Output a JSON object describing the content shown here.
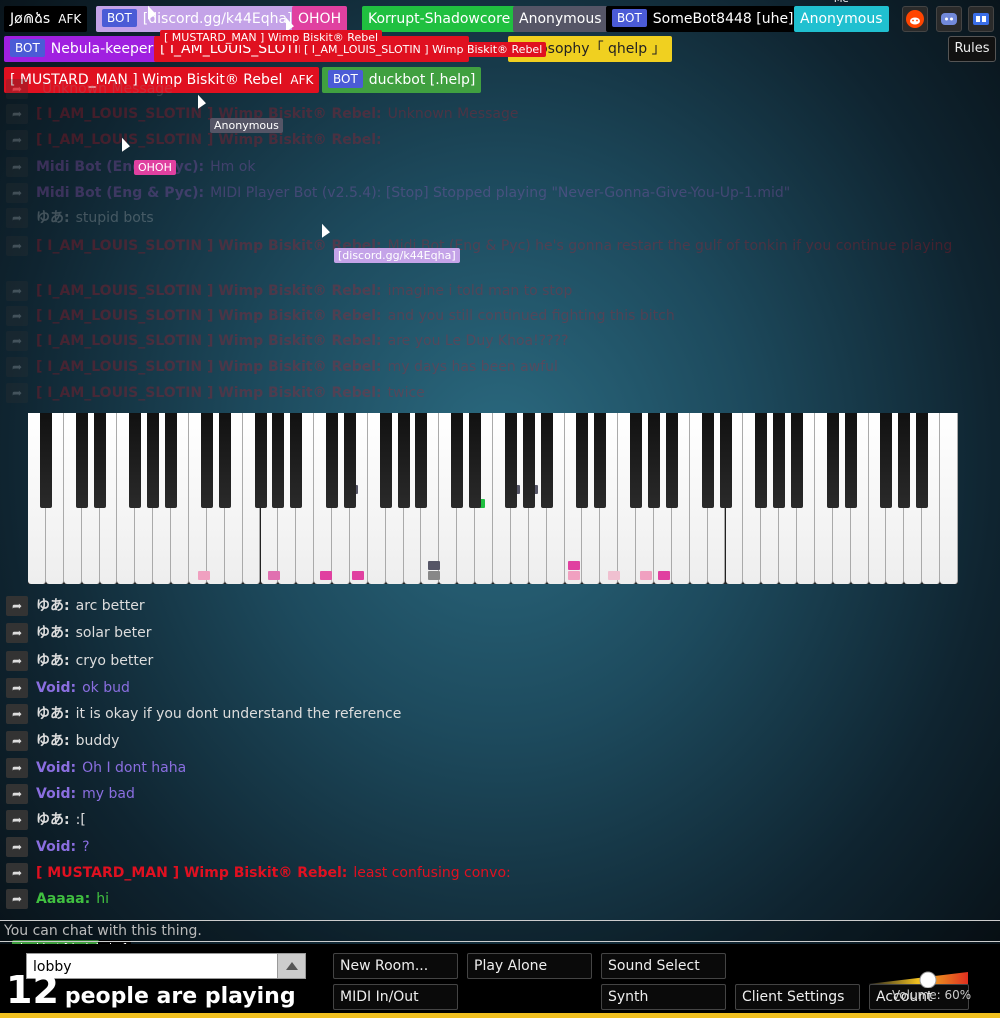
{
  "header": {
    "users": [
      {
        "name": "Jø⋒ձs",
        "afk": "AFK",
        "color": "#000000"
      },
      {
        "bot": "BOT",
        "name": "[discord.gg/k44Eqha]",
        "color": "#c4a3e8"
      },
      {
        "name": "OHOH",
        "color": "#e040a0"
      },
      {
        "name": "Korrupt-Shadowcore",
        "color": "#20c040"
      },
      {
        "name": "Anonymous",
        "color": "#555566"
      },
      {
        "bot": "BOT",
        "name": "SomeBot8448 [uhe]",
        "color": "#000000"
      },
      {
        "name": "Anonymous",
        "me": "Me",
        "color": "#20c0d0"
      },
      {
        "bot": "BOT",
        "name": "Nebula-keeper",
        "color": "#a020e0"
      },
      {
        "name": "[ I_AM_LOUIS_SLOTIN ] Wimp Biskit® Rebel",
        "color": "#e01020"
      },
      {
        "name": "Philosophy「 qhelp 」",
        "color": "#f0d020"
      },
      {
        "name": "[ MUSTARD_MAN ] Wimp Biskit® Rebel",
        "afk": "AFK",
        "color": "#e01020"
      },
      {
        "bot": "BOT",
        "name": "duckbot [.help]",
        "color": "#40a040"
      }
    ],
    "rules_label": "Rules",
    "icons": [
      "reddit-icon",
      "discord-icon",
      "rb-icon"
    ]
  },
  "cursors": [
    {
      "label": "[ MUSTARD_MAN ] Wimp Biskit® Rebel",
      "color": "#e01020"
    },
    {
      "label": "[ I_AM_LOUIS_SLOTIN ] Wimp Biskit® Rebel",
      "color": "#e01020"
    },
    {
      "label": "Anonymous",
      "color": "#555566"
    },
    {
      "label": "OHOH",
      "color": "#e040a0"
    },
    {
      "label": "[discord.gg/k44Eqha]",
      "color": "#c4a3e8"
    },
    {
      "label": "duckbot [.help]",
      "color": "#40a040"
    },
    {
      "label": "uhe]",
      "color": "#000000"
    },
    {
      "label": "Korrupt-Shadowcore",
      "color": "#20c040"
    }
  ],
  "chat_faded": [
    {
      "name": "",
      "text": "Unknown Message",
      "color": "#888888"
    },
    {
      "name": "[ I_AM_LOUIS_SLOTIN ] Wimp Biskit® Rebel:",
      "text": "Unknown Message",
      "color": "#e01020"
    },
    {
      "name": "[ I_AM_LOUIS_SLOTIN ] Wimp Biskit® Rebel:",
      "text": "",
      "color": "#e01020"
    },
    {
      "name": "Midi Bot (Eng & Pyc):",
      "text": "Hm ok",
      "color": "#c060e0"
    },
    {
      "name": "Midi Bot (Eng & Pyc):",
      "text": "MIDI Player Bot (v2.5.4): [Stop] Stopped playing \"Never-Gonna-Give-You-Up-1.mid\"",
      "color": "#c060e0"
    },
    {
      "name": "ゆあ:",
      "text": "stupid bots",
      "color": "#dddddd"
    },
    {
      "name": "[ I_AM_LOUIS_SLOTIN ] Wimp Biskit® Rebel:",
      "text": "Midi Bot (Eng & Pyc)  he's gonna restart the gulf of tonkin if you continue playing",
      "color": "#e01020"
    },
    {
      "name": "[ I_AM_LOUIS_SLOTIN ] Wimp Biskit® Rebel:",
      "text": "imagine i told man to stop",
      "color": "#e01020"
    },
    {
      "name": "[ I_AM_LOUIS_SLOTIN ] Wimp Biskit® Rebel:",
      "text": "and you still continued fighting this bitch",
      "color": "#e01020"
    },
    {
      "name": "[ I_AM_LOUIS_SLOTIN ] Wimp Biskit® Rebel:",
      "text": "are you Le Duy Khoa!????",
      "color": "#e01020"
    },
    {
      "name": "[ I_AM_LOUIS_SLOTIN ] Wimp Biskit® Rebel:",
      "text": "my days has been awful",
      "color": "#e01020"
    },
    {
      "name": "[ I_AM_LOUIS_SLOTIN ] Wimp Biskit® Rebel:",
      "text": "twice",
      "color": "#e01020"
    }
  ],
  "chat": [
    {
      "name": "ゆあ:",
      "text": "arc better",
      "color": "#dddddd"
    },
    {
      "name": "ゆあ:",
      "text": "solar beter",
      "color": "#dddddd"
    },
    {
      "name": "ゆあ:",
      "text": "cryo better",
      "color": "#dddddd"
    },
    {
      "name": "Void:",
      "text": "ok bud",
      "color": "#8a6ee0"
    },
    {
      "name": "ゆあ:",
      "text": "it is okay if you dont understand the reference",
      "color": "#dddddd"
    },
    {
      "name": "ゆあ:",
      "text": "buddy",
      "color": "#dddddd"
    },
    {
      "name": "Void:",
      "text": "Oh I dont haha",
      "color": "#8a6ee0"
    },
    {
      "name": "Void:",
      "text": "my bad",
      "color": "#8a6ee0"
    },
    {
      "name": "ゆあ:",
      "text": ":[",
      "color": "#dddddd"
    },
    {
      "name": "Void:",
      "text": "?",
      "color": "#8a6ee0"
    },
    {
      "name": "[ MUSTARD_MAN ] Wimp Biskit® Rebel:",
      "text": "least confusing convo:",
      "color": "#e01020"
    },
    {
      "name": "Aaaaa:",
      "text": "hi",
      "color": "#40c040"
    }
  ],
  "chat_input": {
    "placeholder": "You can chat with this thing."
  },
  "controls": {
    "room": "lobby",
    "new_room": "New Room...",
    "play_alone": "Play Alone",
    "sound_select": "Sound Select",
    "midi_inout": "MIDI In/Out",
    "synth": "Synth",
    "client_settings": "Client Settings",
    "account": "Account",
    "volume_label": "Volume: 60%",
    "volume_level": 0.6
  },
  "people_count": {
    "num": "12",
    "text": "people are playing"
  }
}
